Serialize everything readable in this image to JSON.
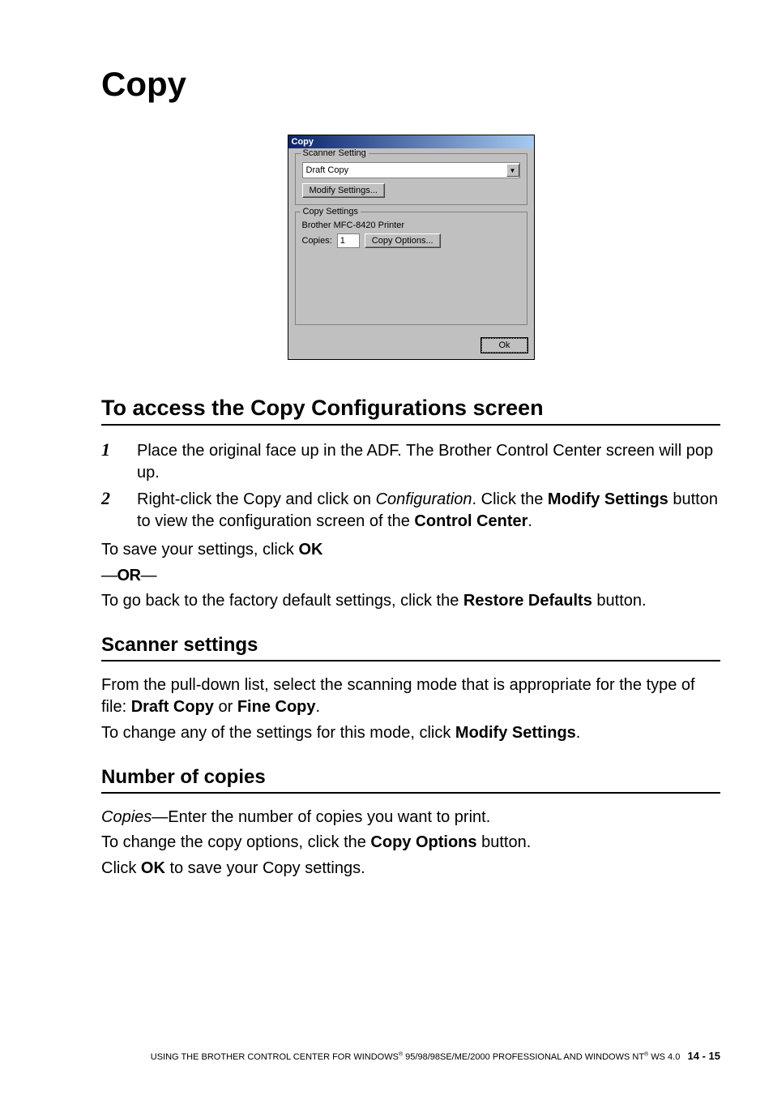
{
  "title": "Copy",
  "dialog": {
    "title": "Copy",
    "scanner_setting_legend": "Scanner Setting",
    "dropdown_value": "Draft Copy",
    "modify_settings_btn": "Modify Settings...",
    "copy_settings_legend": "Copy Settings",
    "printer_line": "Brother MFC-8420 Printer",
    "copies_label": "Copies:",
    "copies_value": "1",
    "copy_options_btn": "Copy Options...",
    "ok_btn": "Ok"
  },
  "sections": {
    "access_heading": "To access the Copy Configurations screen",
    "steps": [
      {
        "num": "1",
        "text": "Place the original face up in the ADF. The Brother Control Center screen will pop up."
      },
      {
        "num": "2",
        "pre": "Right-click the Copy and click on ",
        "i": "Configuration",
        "post1": ". Click the ",
        "b1": "Modify Settings",
        "post2": " button to view the configuration screen of the ",
        "b2": "Control Center",
        "post3": "."
      }
    ],
    "save_pre": "To save your settings, click ",
    "save_b": "OK",
    "or_line": "—OR—",
    "restore_pre": "To go back to the factory default settings, click the ",
    "restore_b": "Restore Defaults",
    "restore_post": " button.",
    "scanner_heading": "Scanner settings",
    "scanner_p_pre": "From the pull-down list, select the scanning mode that is appropriate for the type of file: ",
    "scanner_p_b1": "Draft Copy",
    "scanner_p_mid": " or ",
    "scanner_p_b2": "Fine Copy",
    "scanner_p_post": ".",
    "scanner_change_pre": "To change any of the settings for this mode, click ",
    "scanner_change_b": "Modify Settings",
    "scanner_change_post": ".",
    "noc_heading": "Number of copies",
    "noc_i": "Copies",
    "noc_post": "—Enter the number of copies you want to print.",
    "noc_change_pre": "To change the copy options, click the ",
    "noc_change_b": "Copy Options",
    "noc_change_post": " button.",
    "noc_ok_pre": "Click ",
    "noc_ok_b": "OK",
    "noc_ok_post": " to save your Copy settings."
  },
  "footer": {
    "pre": "USING THE BROTHER CONTROL CENTER FOR WINDOWS",
    "reg": "®",
    "mid": " 95/98/98SE/ME/2000 PROFESSIONAL AND WINDOWS NT",
    "post": " WS 4.0",
    "page": "14 - 15"
  }
}
